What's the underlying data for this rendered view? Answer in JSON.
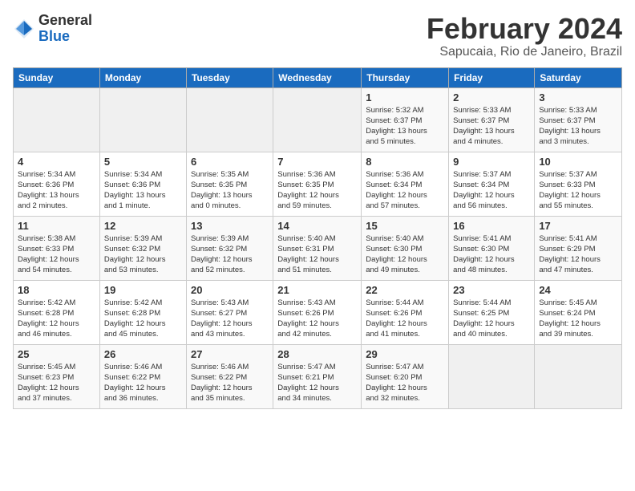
{
  "header": {
    "logo_general": "General",
    "logo_blue": "Blue",
    "month_title": "February 2024",
    "location": "Sapucaia, Rio de Janeiro, Brazil"
  },
  "calendar": {
    "days_of_week": [
      "Sunday",
      "Monday",
      "Tuesday",
      "Wednesday",
      "Thursday",
      "Friday",
      "Saturday"
    ],
    "weeks": [
      [
        {
          "day": "",
          "info": ""
        },
        {
          "day": "",
          "info": ""
        },
        {
          "day": "",
          "info": ""
        },
        {
          "day": "",
          "info": ""
        },
        {
          "day": "1",
          "info": "Sunrise: 5:32 AM\nSunset: 6:37 PM\nDaylight: 13 hours\nand 5 minutes."
        },
        {
          "day": "2",
          "info": "Sunrise: 5:33 AM\nSunset: 6:37 PM\nDaylight: 13 hours\nand 4 minutes."
        },
        {
          "day": "3",
          "info": "Sunrise: 5:33 AM\nSunset: 6:37 PM\nDaylight: 13 hours\nand 3 minutes."
        }
      ],
      [
        {
          "day": "4",
          "info": "Sunrise: 5:34 AM\nSunset: 6:36 PM\nDaylight: 13 hours\nand 2 minutes."
        },
        {
          "day": "5",
          "info": "Sunrise: 5:34 AM\nSunset: 6:36 PM\nDaylight: 13 hours\nand 1 minute."
        },
        {
          "day": "6",
          "info": "Sunrise: 5:35 AM\nSunset: 6:35 PM\nDaylight: 13 hours\nand 0 minutes."
        },
        {
          "day": "7",
          "info": "Sunrise: 5:36 AM\nSunset: 6:35 PM\nDaylight: 12 hours\nand 59 minutes."
        },
        {
          "day": "8",
          "info": "Sunrise: 5:36 AM\nSunset: 6:34 PM\nDaylight: 12 hours\nand 57 minutes."
        },
        {
          "day": "9",
          "info": "Sunrise: 5:37 AM\nSunset: 6:34 PM\nDaylight: 12 hours\nand 56 minutes."
        },
        {
          "day": "10",
          "info": "Sunrise: 5:37 AM\nSunset: 6:33 PM\nDaylight: 12 hours\nand 55 minutes."
        }
      ],
      [
        {
          "day": "11",
          "info": "Sunrise: 5:38 AM\nSunset: 6:33 PM\nDaylight: 12 hours\nand 54 minutes."
        },
        {
          "day": "12",
          "info": "Sunrise: 5:39 AM\nSunset: 6:32 PM\nDaylight: 12 hours\nand 53 minutes."
        },
        {
          "day": "13",
          "info": "Sunrise: 5:39 AM\nSunset: 6:32 PM\nDaylight: 12 hours\nand 52 minutes."
        },
        {
          "day": "14",
          "info": "Sunrise: 5:40 AM\nSunset: 6:31 PM\nDaylight: 12 hours\nand 51 minutes."
        },
        {
          "day": "15",
          "info": "Sunrise: 5:40 AM\nSunset: 6:30 PM\nDaylight: 12 hours\nand 49 minutes."
        },
        {
          "day": "16",
          "info": "Sunrise: 5:41 AM\nSunset: 6:30 PM\nDaylight: 12 hours\nand 48 minutes."
        },
        {
          "day": "17",
          "info": "Sunrise: 5:41 AM\nSunset: 6:29 PM\nDaylight: 12 hours\nand 47 minutes."
        }
      ],
      [
        {
          "day": "18",
          "info": "Sunrise: 5:42 AM\nSunset: 6:28 PM\nDaylight: 12 hours\nand 46 minutes."
        },
        {
          "day": "19",
          "info": "Sunrise: 5:42 AM\nSunset: 6:28 PM\nDaylight: 12 hours\nand 45 minutes."
        },
        {
          "day": "20",
          "info": "Sunrise: 5:43 AM\nSunset: 6:27 PM\nDaylight: 12 hours\nand 43 minutes."
        },
        {
          "day": "21",
          "info": "Sunrise: 5:43 AM\nSunset: 6:26 PM\nDaylight: 12 hours\nand 42 minutes."
        },
        {
          "day": "22",
          "info": "Sunrise: 5:44 AM\nSunset: 6:26 PM\nDaylight: 12 hours\nand 41 minutes."
        },
        {
          "day": "23",
          "info": "Sunrise: 5:44 AM\nSunset: 6:25 PM\nDaylight: 12 hours\nand 40 minutes."
        },
        {
          "day": "24",
          "info": "Sunrise: 5:45 AM\nSunset: 6:24 PM\nDaylight: 12 hours\nand 39 minutes."
        }
      ],
      [
        {
          "day": "25",
          "info": "Sunrise: 5:45 AM\nSunset: 6:23 PM\nDaylight: 12 hours\nand 37 minutes."
        },
        {
          "day": "26",
          "info": "Sunrise: 5:46 AM\nSunset: 6:22 PM\nDaylight: 12 hours\nand 36 minutes."
        },
        {
          "day": "27",
          "info": "Sunrise: 5:46 AM\nSunset: 6:22 PM\nDaylight: 12 hours\nand 35 minutes."
        },
        {
          "day": "28",
          "info": "Sunrise: 5:47 AM\nSunset: 6:21 PM\nDaylight: 12 hours\nand 34 minutes."
        },
        {
          "day": "29",
          "info": "Sunrise: 5:47 AM\nSunset: 6:20 PM\nDaylight: 12 hours\nand 32 minutes."
        },
        {
          "day": "",
          "info": ""
        },
        {
          "day": "",
          "info": ""
        }
      ]
    ]
  }
}
